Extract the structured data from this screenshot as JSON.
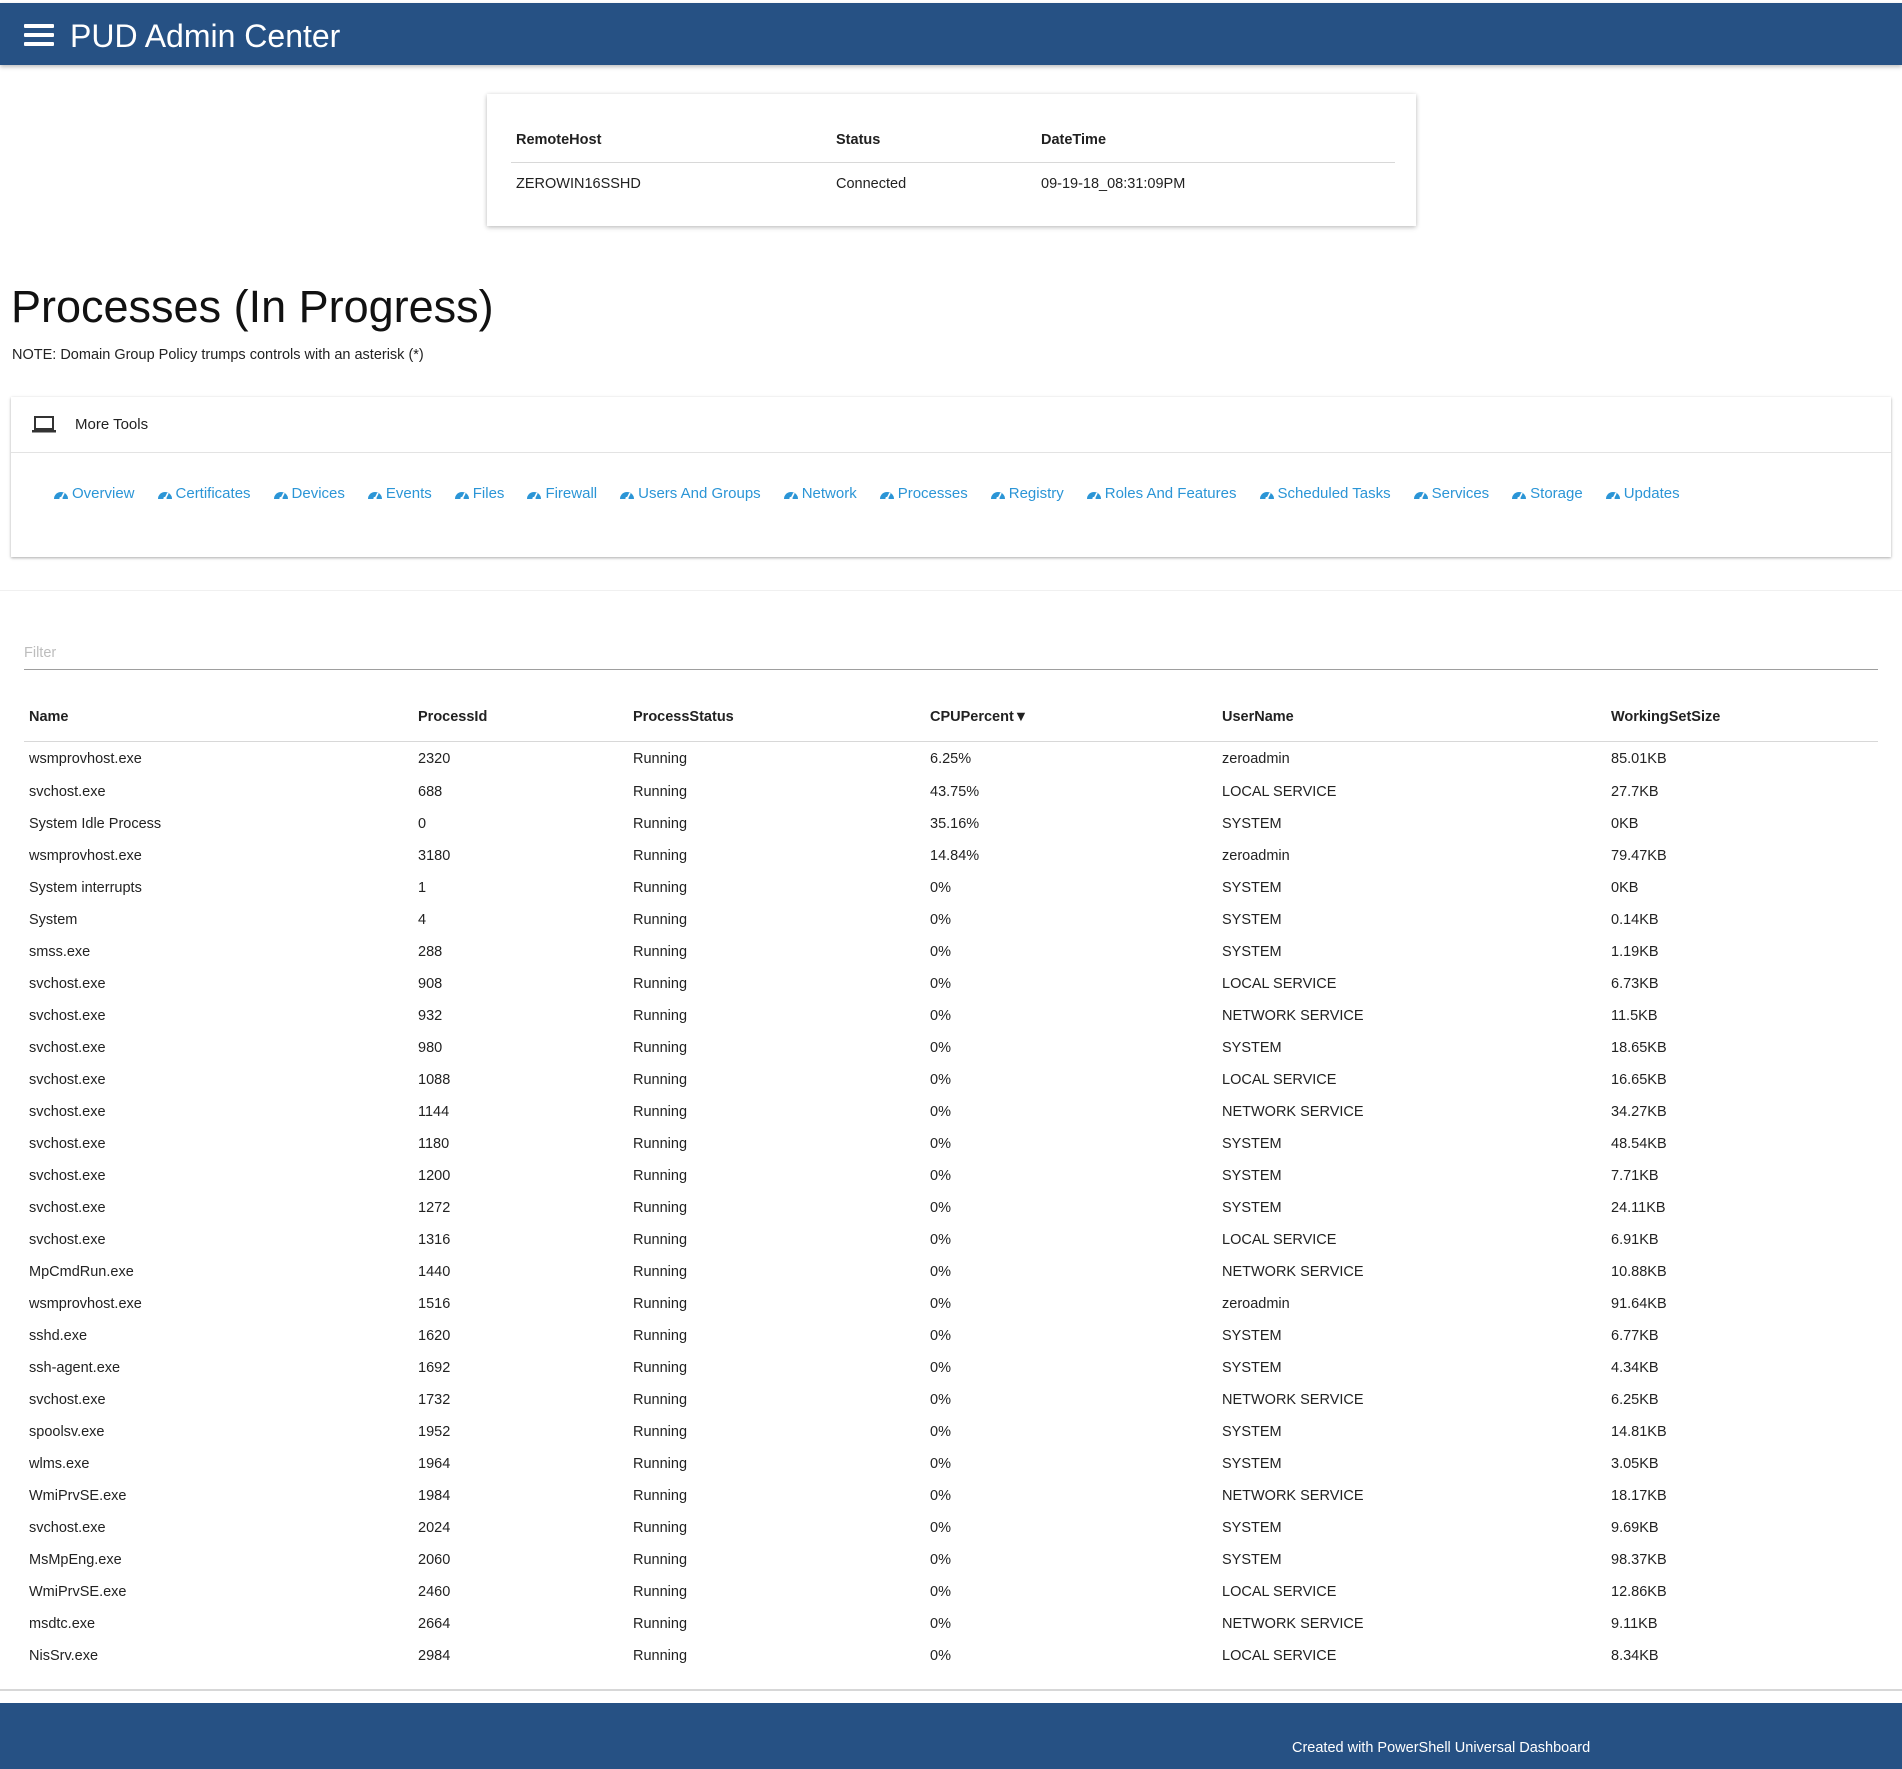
{
  "app": {
    "title": "PUD Admin Center",
    "brand_color": "#265184",
    "link_color": "#2b95d6"
  },
  "connection": {
    "headers": [
      "RemoteHost",
      "Status",
      "DateTime"
    ],
    "row": [
      "ZEROWIN16SSHD",
      "Connected",
      "09-19-18_08:31:09PM"
    ]
  },
  "page": {
    "title": "Processes (In Progress)",
    "note": "NOTE: Domain Group Policy trumps controls with an asterisk (*)"
  },
  "tools": {
    "label": "More Tools",
    "icon": "laptop-icon",
    "links": [
      "Overview",
      "Certificates",
      "Devices",
      "Events",
      "Files",
      "Firewall",
      "Users And Groups",
      "Network",
      "Processes",
      "Registry",
      "Roles And Features",
      "Scheduled Tasks",
      "Services",
      "Storage",
      "Updates"
    ],
    "link_icon": "dashboard-gauge-icon"
  },
  "processes": {
    "filter_placeholder": "Filter",
    "headers": [
      "Name",
      "ProcessId",
      "ProcessStatus",
      "CPUPercent▼",
      "UserName",
      "WorkingSetSize"
    ],
    "rows": [
      [
        "wsmprovhost.exe",
        "2320",
        "Running",
        "6.25%",
        "zeroadmin",
        "85.01KB"
      ],
      [
        "svchost.exe",
        "688",
        "Running",
        "43.75%",
        "LOCAL SERVICE",
        "27.7KB"
      ],
      [
        "System Idle Process",
        "0",
        "Running",
        "35.16%",
        "SYSTEM",
        "0KB"
      ],
      [
        "wsmprovhost.exe",
        "3180",
        "Running",
        "14.84%",
        "zeroadmin",
        "79.47KB"
      ],
      [
        "System interrupts",
        "1",
        "Running",
        "0%",
        "SYSTEM",
        "0KB"
      ],
      [
        "System",
        "4",
        "Running",
        "0%",
        "SYSTEM",
        "0.14KB"
      ],
      [
        "smss.exe",
        "288",
        "Running",
        "0%",
        "SYSTEM",
        "1.19KB"
      ],
      [
        "svchost.exe",
        "908",
        "Running",
        "0%",
        "LOCAL SERVICE",
        "6.73KB"
      ],
      [
        "svchost.exe",
        "932",
        "Running",
        "0%",
        "NETWORK SERVICE",
        "11.5KB"
      ],
      [
        "svchost.exe",
        "980",
        "Running",
        "0%",
        "SYSTEM",
        "18.65KB"
      ],
      [
        "svchost.exe",
        "1088",
        "Running",
        "0%",
        "LOCAL SERVICE",
        "16.65KB"
      ],
      [
        "svchost.exe",
        "1144",
        "Running",
        "0%",
        "NETWORK SERVICE",
        "34.27KB"
      ],
      [
        "svchost.exe",
        "1180",
        "Running",
        "0%",
        "SYSTEM",
        "48.54KB"
      ],
      [
        "svchost.exe",
        "1200",
        "Running",
        "0%",
        "SYSTEM",
        "7.71KB"
      ],
      [
        "svchost.exe",
        "1272",
        "Running",
        "0%",
        "SYSTEM",
        "24.11KB"
      ],
      [
        "svchost.exe",
        "1316",
        "Running",
        "0%",
        "LOCAL SERVICE",
        "6.91KB"
      ],
      [
        "MpCmdRun.exe",
        "1440",
        "Running",
        "0%",
        "NETWORK SERVICE",
        "10.88KB"
      ],
      [
        "wsmprovhost.exe",
        "1516",
        "Running",
        "0%",
        "zeroadmin",
        "91.64KB"
      ],
      [
        "sshd.exe",
        "1620",
        "Running",
        "0%",
        "SYSTEM",
        "6.77KB"
      ],
      [
        "ssh-agent.exe",
        "1692",
        "Running",
        "0%",
        "SYSTEM",
        "4.34KB"
      ],
      [
        "svchost.exe",
        "1732",
        "Running",
        "0%",
        "NETWORK SERVICE",
        "6.25KB"
      ],
      [
        "spoolsv.exe",
        "1952",
        "Running",
        "0%",
        "SYSTEM",
        "14.81KB"
      ],
      [
        "wlms.exe",
        "1964",
        "Running",
        "0%",
        "SYSTEM",
        "3.05KB"
      ],
      [
        "WmiPrvSE.exe",
        "1984",
        "Running",
        "0%",
        "NETWORK SERVICE",
        "18.17KB"
      ],
      [
        "svchost.exe",
        "2024",
        "Running",
        "0%",
        "SYSTEM",
        "9.69KB"
      ],
      [
        "MsMpEng.exe",
        "2060",
        "Running",
        "0%",
        "SYSTEM",
        "98.37KB"
      ],
      [
        "WmiPrvSE.exe",
        "2460",
        "Running",
        "0%",
        "LOCAL SERVICE",
        "12.86KB"
      ],
      [
        "msdtc.exe",
        "2664",
        "Running",
        "0%",
        "NETWORK SERVICE",
        "9.11KB"
      ],
      [
        "NisSrv.exe",
        "2984",
        "Running",
        "0%",
        "LOCAL SERVICE",
        "8.34KB"
      ]
    ]
  },
  "footer": {
    "text": "Created with PowerShell Universal Dashboard"
  }
}
